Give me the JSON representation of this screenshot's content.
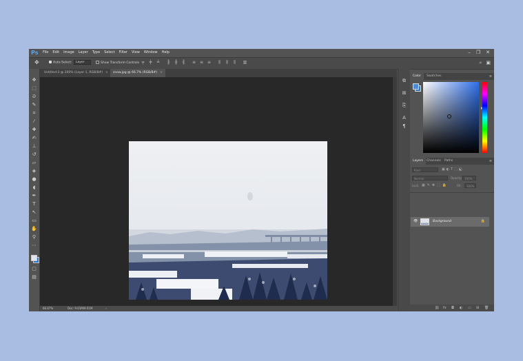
{
  "app": {
    "logo": "Ps"
  },
  "menu": [
    "File",
    "Edit",
    "Image",
    "Layer",
    "Type",
    "Select",
    "Filter",
    "View",
    "Window",
    "Help"
  ],
  "window_controls": [
    "minimize-icon",
    "restore-icon",
    "close-icon"
  ],
  "options_bar": {
    "auto_select_label": "Auto-Select:",
    "auto_select_checked": true,
    "auto_select_value": "Layer",
    "transform_label": "Show Transform Controls",
    "transform_checked": false
  },
  "tabs": [
    {
      "label": "Untitled-3 @ 200% (Layer 1, RGB/8#)",
      "active": false
    },
    {
      "label": "snow.jpg @ 66.7% (RGB/8#)",
      "active": true
    }
  ],
  "tab_close": "×",
  "status": {
    "zoom": "66.67%",
    "doc": "Doc: 9.01M/9.01M",
    "arrow": "›"
  },
  "color_panel": {
    "tabs": [
      "Color",
      "Swatches"
    ],
    "fg_color": "#4f8ad6",
    "bg_color": "#2b78c8"
  },
  "layers_panel": {
    "tabs": [
      "Layers",
      "Channels",
      "Paths"
    ],
    "filter_placeholder": "Kind",
    "blend_mode": "Normal",
    "opacity_label": "Opacity:",
    "opacity_value": "100%",
    "lock_label": "Lock:",
    "fill_label": "Fill:",
    "fill_value": "100%",
    "layers": [
      {
        "name": "Background",
        "visible": true,
        "locked": true
      }
    ]
  }
}
